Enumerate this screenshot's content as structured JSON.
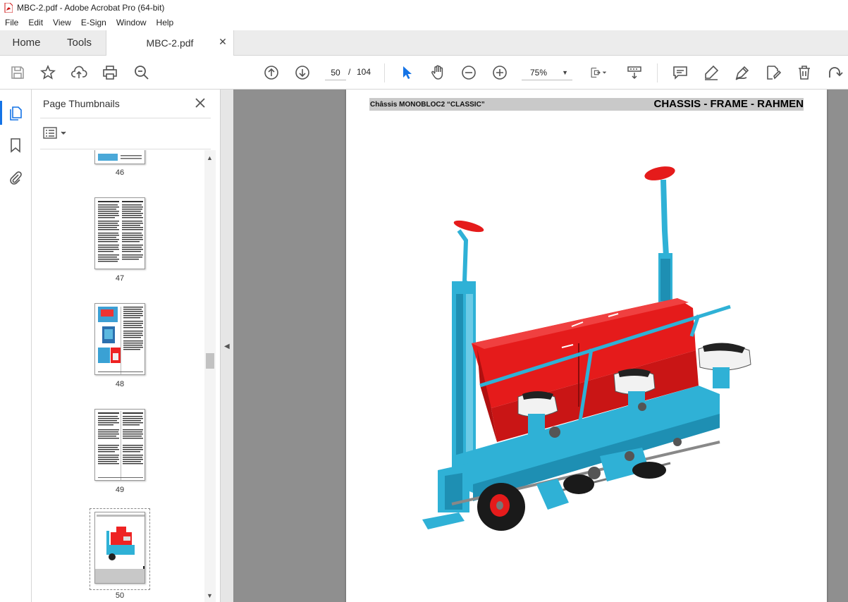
{
  "window": {
    "title": "MBC-2.pdf - Adobe Acrobat Pro (64-bit)"
  },
  "menu": [
    "File",
    "Edit",
    "View",
    "E-Sign",
    "Window",
    "Help"
  ],
  "tabs": {
    "home": "Home",
    "tools": "Tools",
    "document": "MBC-2.pdf"
  },
  "toolbar": {
    "current_page": "50",
    "page_separator": "/",
    "total_pages": "104",
    "zoom": "75%"
  },
  "icons": {
    "save": "save-icon",
    "star": "star-icon",
    "upload": "upload-icon",
    "print": "print-icon",
    "zoom_search": "zoom-search-icon",
    "prev_page": "arrow-up-circle-icon",
    "next_page": "arrow-down-circle-icon",
    "select": "pointer-icon",
    "hand": "hand-icon",
    "zoom_out": "zoom-out-icon",
    "zoom_in": "zoom-in-icon",
    "page_fit": "page-fit-icon",
    "scroll_mode": "scroll-mode-icon",
    "comment": "comment-icon",
    "highlight": "highlight-pen-icon",
    "draw": "draw-icon",
    "edit_tools": "edit-icon",
    "delete": "trash-icon",
    "rotate": "rotate-icon"
  },
  "sidebar": {
    "panel_title": "Page Thumbnails",
    "thumbnails": [
      {
        "page": "46"
      },
      {
        "page": "47"
      },
      {
        "page": "48"
      },
      {
        "page": "49"
      },
      {
        "page": "50",
        "selected": true
      }
    ]
  },
  "document": {
    "header_left": "Châssis MONOBLOC2 “CLASSIC”",
    "header_right": "CHASSIS - FRAME - RAHMEN"
  },
  "colors": {
    "accent_blue": "#1473e6",
    "frame_blue": "#2fb1d6",
    "hopper_red": "#e51b1b",
    "background_gray": "#8f8f8f"
  }
}
